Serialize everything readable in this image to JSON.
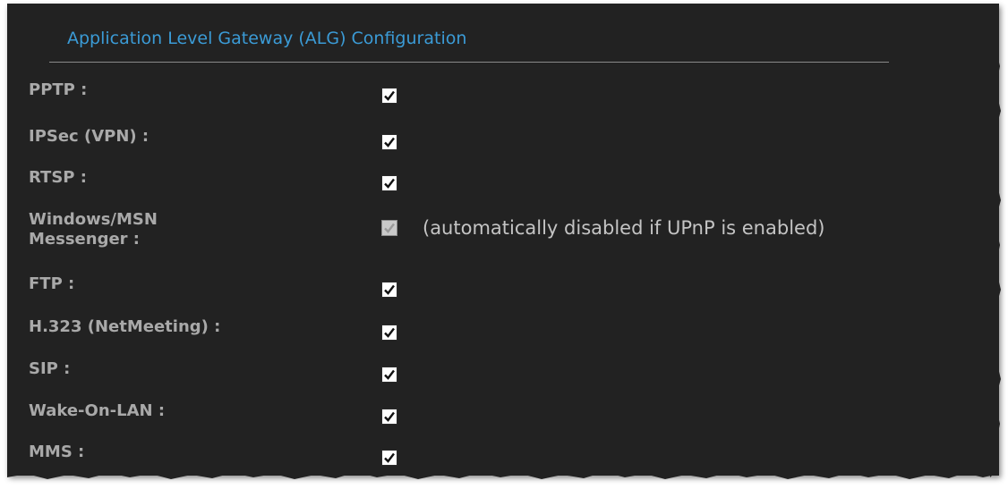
{
  "section": {
    "title": "Application Level Gateway (ALG) Configuration"
  },
  "rows": [
    {
      "label": "PPTP :",
      "checked": true,
      "disabled": false
    },
    {
      "label": "IPSec (VPN) :",
      "checked": true,
      "disabled": false
    },
    {
      "label": "RTSP :",
      "checked": true,
      "disabled": false
    },
    {
      "label_line1": "Windows/MSN",
      "label_line2": "Messenger :",
      "checked": true,
      "disabled": true,
      "note": "(automatically disabled if UPnP is enabled)"
    },
    {
      "label": "FTP :",
      "checked": true,
      "disabled": false
    },
    {
      "label": "H.323 (NetMeeting) :",
      "checked": true,
      "disabled": false
    },
    {
      "label": "SIP :",
      "checked": true,
      "disabled": false
    },
    {
      "label": "Wake-On-LAN :",
      "checked": true,
      "disabled": false
    },
    {
      "label": "MMS :",
      "checked": true,
      "disabled": false
    }
  ],
  "colors": {
    "panel_background": "#222222",
    "title_color": "#3b9bd6",
    "label_color": "#a9a9a9",
    "note_color": "#c4c4c4"
  },
  "icons": {
    "checkbox": "checkmark-icon"
  }
}
